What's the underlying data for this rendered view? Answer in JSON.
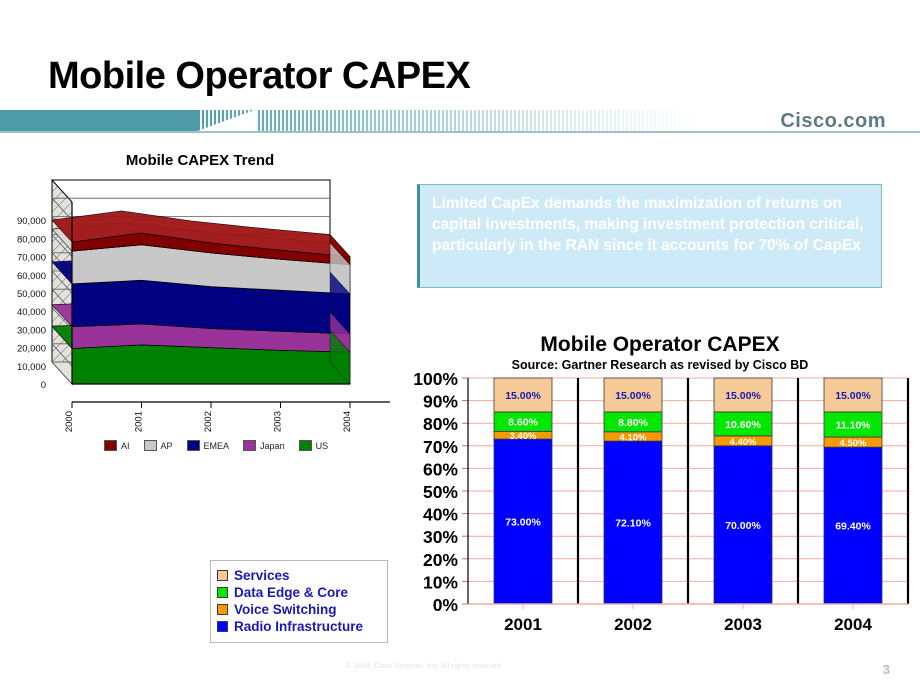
{
  "slide": {
    "title": "Mobile Operator CAPEX",
    "brand": "Cisco.com",
    "page_number": "3",
    "copyright": "© 2004, Cisco Systems, Inc. All rights reserved."
  },
  "callout": {
    "text": "Limited CapEx demands the maximization of returns on capital investments, making investment protection critical, particularly in the RAN since it accounts for 70% of CapEx"
  },
  "area_legend": [
    {
      "label": "AI",
      "color": "#800000"
    },
    {
      "label": "AP",
      "color": "#c8c8c8"
    },
    {
      "label": "EMEA",
      "color": "#000080"
    },
    {
      "label": "Japan",
      "color": "#993399"
    },
    {
      "label": "US",
      "color": "#008000"
    }
  ],
  "bar_legend": [
    {
      "label": "Services",
      "color": "#f5ca96"
    },
    {
      "label": "Data Edge & Core",
      "color": "#00e800"
    },
    {
      "label": "Voice Switching",
      "color": "#f59a00"
    },
    {
      "label": "Radio Infrastructure",
      "color": "#0000ff"
    }
  ],
  "chart_data": [
    {
      "id": "mobile-capex-trend",
      "type": "area",
      "title": "Mobile CAPEX Trend",
      "xlabel": "",
      "ylabel": "",
      "categories": [
        "2000",
        "2001",
        "2002",
        "2003",
        "2004"
      ],
      "ytick_labels": [
        "0",
        "10,000",
        "20,000",
        "30,000",
        "40,000",
        "50,000",
        "60,000",
        "70,000",
        "80,000",
        "90,000"
      ],
      "ylim": [
        0,
        100000
      ],
      "grid": true,
      "stacked": true,
      "legend_position": "bottom",
      "series": [
        {
          "name": "US",
          "color": "#008000",
          "values": [
            19500,
            21500,
            20000,
            18500,
            17500
          ]
        },
        {
          "name": "Japan",
          "color": "#993399",
          "values": [
            12000,
            11500,
            10500,
            10500,
            10000
          ]
        },
        {
          "name": "EMEA",
          "color": "#000080",
          "values": [
            23500,
            24000,
            23000,
            22500,
            22000
          ]
        },
        {
          "name": "AP",
          "color": "#c8c8c8",
          "values": [
            18000,
            19500,
            18500,
            17000,
            16000
          ]
        },
        {
          "name": "AI",
          "color": "#800000",
          "values": [
            5000,
            6500,
            5500,
            5000,
            4500
          ]
        }
      ]
    },
    {
      "id": "mobile-operator-capex",
      "type": "bar",
      "title": "Mobile Operator CAPEX",
      "subtitle": "Source: Gartner Research as revised by Cisco BD",
      "xlabel": "",
      "ylabel": "",
      "categories": [
        "2001",
        "2002",
        "2003",
        "2004"
      ],
      "ytick_labels": [
        "0%",
        "10%",
        "20%",
        "30%",
        "40%",
        "50%",
        "60%",
        "70%",
        "80%",
        "90%",
        "100%"
      ],
      "ylim": [
        0,
        100
      ],
      "grid": true,
      "stacked": true,
      "legend_position": "external-bottom-left",
      "series": [
        {
          "name": "Radio Infrastructure",
          "color": "#0000ff",
          "label_color": "#ffffff",
          "values": [
            73.0,
            72.1,
            70.0,
            69.4
          ],
          "labels": [
            "73.00%",
            "72.10%",
            "70.00%",
            "69.40%"
          ]
        },
        {
          "name": "Voice Switching",
          "color": "#f59a00",
          "label_color": "#ffffff",
          "values": [
            3.4,
            4.1,
            4.4,
            4.5
          ],
          "labels": [
            "3.40%",
            "4.10%",
            "4.40%",
            "4.50%"
          ]
        },
        {
          "name": "Data Edge & Core",
          "color": "#00e800",
          "label_color": "#ffffff",
          "values": [
            8.6,
            8.8,
            10.6,
            11.1
          ],
          "labels": [
            "8.60%",
            "8.80%",
            "10.60%",
            "11.10%"
          ]
        },
        {
          "name": "Services",
          "color": "#f5ca96",
          "label_color": "#1919b3",
          "values": [
            15.0,
            15.0,
            15.0,
            15.0
          ],
          "labels": [
            "15.00%",
            "15.00%",
            "15.00%",
            "15.00%"
          ]
        }
      ]
    }
  ]
}
